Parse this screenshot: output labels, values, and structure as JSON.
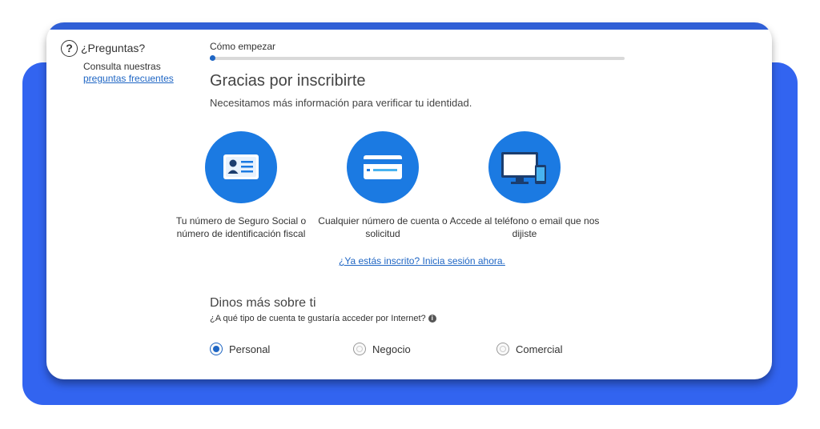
{
  "help": {
    "icon": "question-circle-icon",
    "title": "¿Preguntas?",
    "subtitle": "Consulta nuestras",
    "link": "preguntas frecuentes"
  },
  "progress": {
    "step_label": "Cómo empezar",
    "fraction": 0.01
  },
  "main": {
    "title": "Gracias por inscribirte",
    "subtitle": "Necesitamos más información para verificar tu identidad.",
    "options": [
      {
        "icon": "id-card-icon",
        "label": "Tu número de Seguro Social o número de identificación fiscal"
      },
      {
        "icon": "credit-card-icon",
        "label": "Cualquier número de cuenta o solicitud"
      },
      {
        "icon": "monitor-phone-icon",
        "label": "Accede al teléfono o email que nos dijiste"
      }
    ],
    "signin_link": "¿Ya estás inscrito? Inicia sesión ahora."
  },
  "account": {
    "title": "Dinos más sobre ti",
    "question": "¿A qué tipo de cuenta te gustaría acceder por Internet?",
    "options": [
      {
        "label": "Personal",
        "selected": true
      },
      {
        "label": "Negocio",
        "selected": false
      },
      {
        "label": "Comercial",
        "selected": false
      }
    ]
  },
  "colors": {
    "accent": "#1f66c4",
    "icon_circle": "#1b7ae2",
    "backdrop": "#3264f0"
  }
}
